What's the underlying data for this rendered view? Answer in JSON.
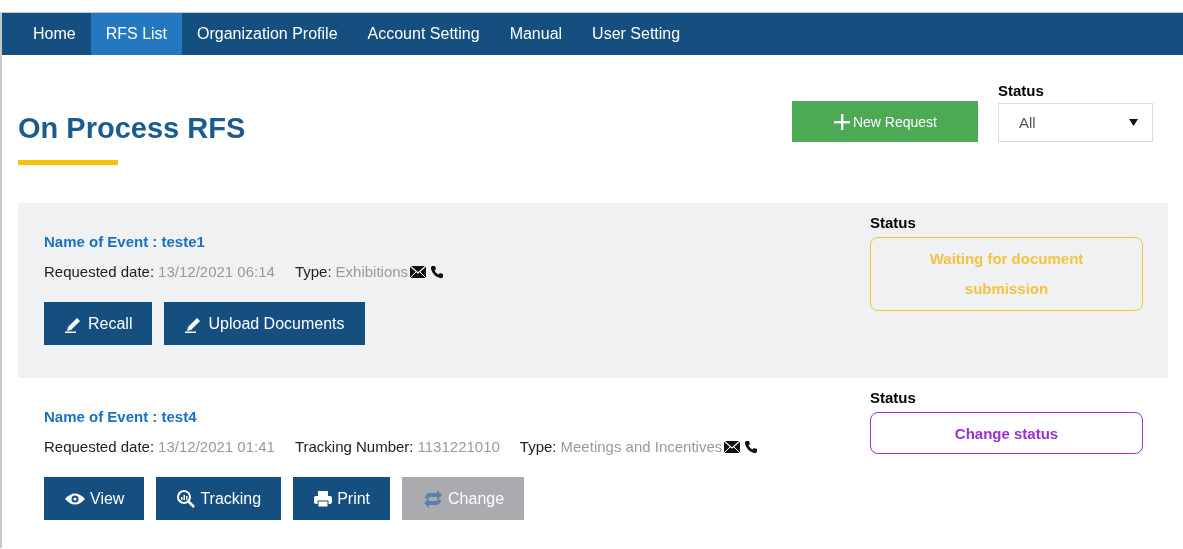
{
  "nav": [
    {
      "label": "Home",
      "selected": false
    },
    {
      "label": "RFS List",
      "selected": true
    },
    {
      "label": "Organization Profile",
      "selected": false
    },
    {
      "label": "Account Setting",
      "selected": false
    },
    {
      "label": "Manual",
      "selected": false
    },
    {
      "label": "User Setting",
      "selected": false
    }
  ],
  "page_title": "On Process RFS",
  "new_request_button": "New Request",
  "status_filter": {
    "label": "Status",
    "value": "All"
  },
  "requests": [
    {
      "name": "Name of Event : teste1",
      "details": [
        {
          "label": "Requested date:",
          "value": "13/12/2021 06:14"
        },
        {
          "label": "Type:",
          "value": "Exhibitions"
        }
      ],
      "actions": [
        {
          "label": "Recall",
          "kind": "edit",
          "disabled": false
        },
        {
          "label": "Upload Documents",
          "kind": "edit",
          "disabled": false
        }
      ],
      "status": {
        "label": "Status",
        "text": "Waiting for document submission",
        "kind": "badge",
        "color": "#f5c342"
      }
    },
    {
      "name": "Name of Event : test4",
      "details": [
        {
          "label": "Requested date:",
          "value": "13/12/2021 01:41"
        },
        {
          "label": "Tracking Number:",
          "value": "1131221010"
        },
        {
          "label": "Type:",
          "value": "Meetings and Incentives"
        }
      ],
      "actions": [
        {
          "label": "View",
          "kind": "view",
          "disabled": false
        },
        {
          "label": "Tracking",
          "kind": "tracking",
          "disabled": false
        },
        {
          "label": "Print",
          "kind": "print",
          "disabled": false
        },
        {
          "label": "Change",
          "kind": "change",
          "disabled": true
        }
      ],
      "status": {
        "label": "Status",
        "text": "Change status",
        "kind": "button",
        "color": "#9b30d0"
      }
    }
  ]
}
